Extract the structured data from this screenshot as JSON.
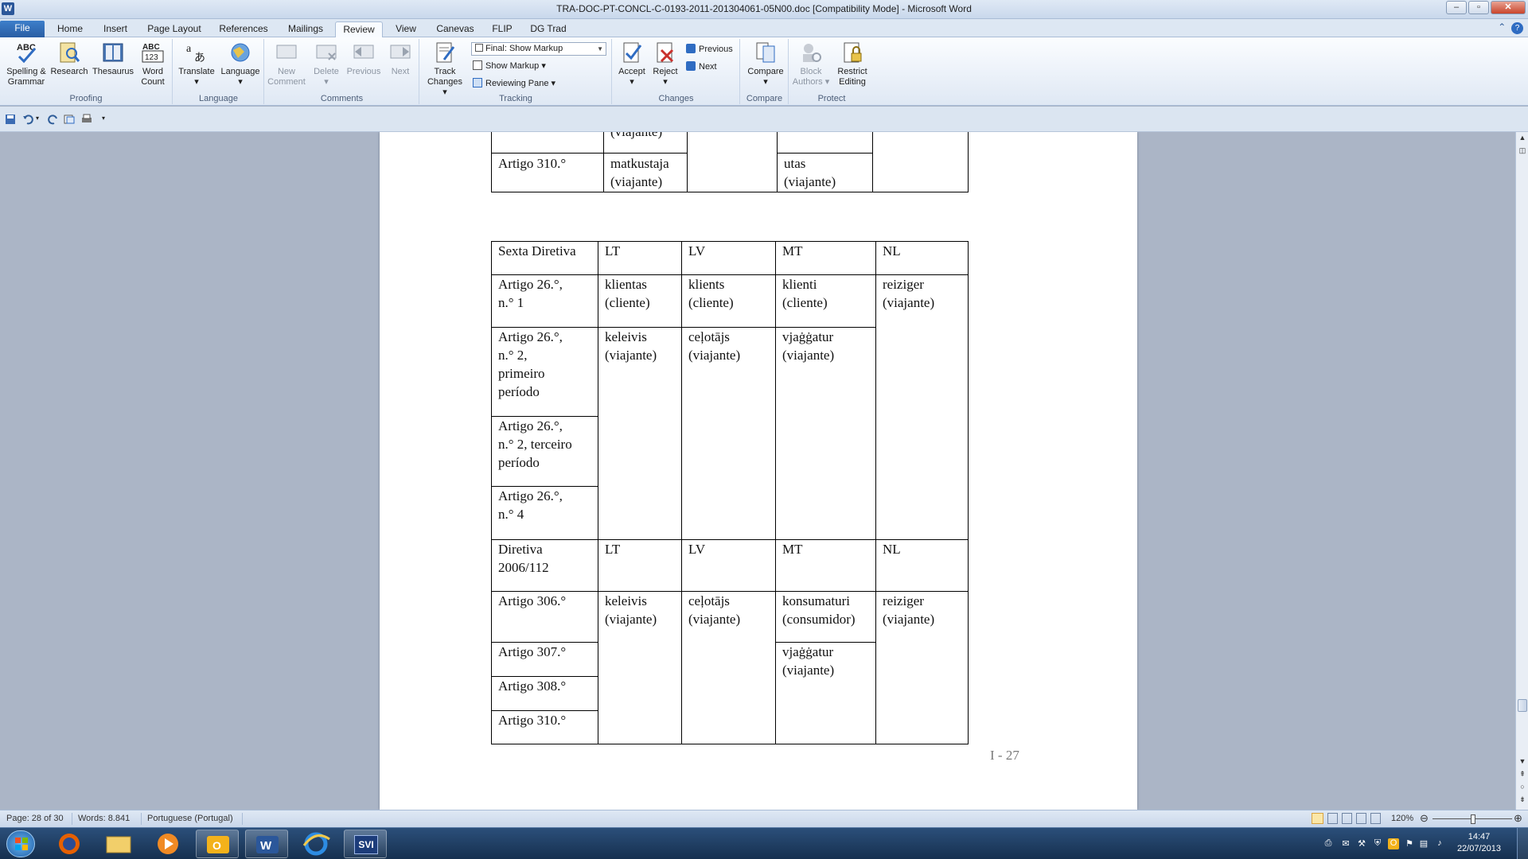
{
  "window": {
    "title": "TRA-DOC-PT-CONCL-C-0193-2011-201304061-05N00.doc [Compatibility Mode] - Microsoft Word",
    "app_icon": "W",
    "minimize": "–",
    "restore": "▫",
    "close": "✕"
  },
  "tabs": [
    "File",
    "Home",
    "Insert",
    "Page Layout",
    "References",
    "Mailings",
    "Review",
    "View",
    "Canevas",
    "FLIP",
    "DG Trad"
  ],
  "active_tab": "Review",
  "ribbon": {
    "proofing": {
      "label": "Proofing",
      "spelling": [
        "Spelling &",
        "Grammar"
      ],
      "research": "Research",
      "thesaurus": "Thesaurus",
      "wordcount": [
        "Word",
        "Count"
      ]
    },
    "language": {
      "label": "Language",
      "translate": "Translate",
      "language": "Language"
    },
    "comments": {
      "label": "Comments",
      "new": [
        "New",
        "Comment"
      ],
      "delete": "Delete",
      "previous": "Previous",
      "next": "Next"
    },
    "tracking": {
      "label": "Tracking",
      "track": [
        "Track",
        "Changes"
      ],
      "display": "Final: Show Markup",
      "show_markup": "Show Markup",
      "reviewing_pane": "Reviewing Pane"
    },
    "changes": {
      "label": "Changes",
      "accept": "Accept",
      "reject": "Reject",
      "previous": "Previous",
      "next": "Next"
    },
    "compare": {
      "label": "Compare",
      "compare": "Compare"
    },
    "protect": {
      "label": "Protect",
      "block": [
        "Block",
        "Authors"
      ],
      "restrict": [
        "Restrict",
        "Editing"
      ]
    }
  },
  "document": {
    "top_table": {
      "partial_text": "(viajante)",
      "row_label": "Artigo 310.°",
      "col2": [
        "matkustaja",
        "(viajante)"
      ],
      "col4": [
        "utas",
        "(viajante)"
      ]
    },
    "main_table": {
      "header1": {
        "label": "Sexta Diretiva",
        "cols": [
          "LT",
          "LV",
          "MT",
          "NL"
        ]
      },
      "sexta_rows": [
        [
          "Artigo 26.°,",
          "n.° 1"
        ],
        [
          "Artigo 26.°,",
          "n.° 2,",
          "primeiro",
          "período"
        ],
        [
          "Artigo 26.°,",
          "n.° 2, terceiro",
          "período"
        ],
        [
          "Artigo 26.°,",
          "n.° 4"
        ]
      ],
      "sexta_values": {
        "lt1": [
          "klientas",
          "(cliente)"
        ],
        "lv1": [
          "klients",
          "(cliente)"
        ],
        "mt1": [
          "klienti",
          "(cliente)"
        ],
        "nl": [
          "reiziger",
          "(viajante)"
        ],
        "lt2": [
          "keleivis",
          "(viajante)"
        ],
        "lv2": [
          "ceļotājs",
          "(viajante)"
        ],
        "mt2": [
          "vjaġġatur",
          "(viajante)"
        ]
      },
      "header2": {
        "label": [
          "Diretiva",
          "2006/112"
        ],
        "cols": [
          "LT",
          "LV",
          "MT",
          "NL"
        ]
      },
      "diretiva_rows": [
        "Artigo 306.°",
        "Artigo 307.°",
        "Artigo 308.°",
        "Artigo 310.°"
      ],
      "diretiva_values": {
        "lt": [
          "keleivis",
          "(viajante)"
        ],
        "lv": [
          "ceļotājs",
          "(viajante)"
        ],
        "mt1": [
          "konsumaturi",
          "(consumidor)"
        ],
        "mt2": [
          "vjaġġatur",
          "(viajante)"
        ],
        "nl": [
          "reiziger",
          "(viajante)"
        ]
      }
    },
    "page_number": "I - 27"
  },
  "status": {
    "page": "Page: 28 of 30",
    "words": "Words: 8.841",
    "language": "Portuguese (Portugal)",
    "zoom": "120%"
  },
  "taskbar": {
    "clock_time": "14:47",
    "clock_date": "22/07/2013",
    "svi_label": "SVI"
  },
  "colors": {
    "ribbon_accent": "#2b579a",
    "file_tab": "#2a5ea4",
    "taskbar": "#1d3a5e"
  }
}
